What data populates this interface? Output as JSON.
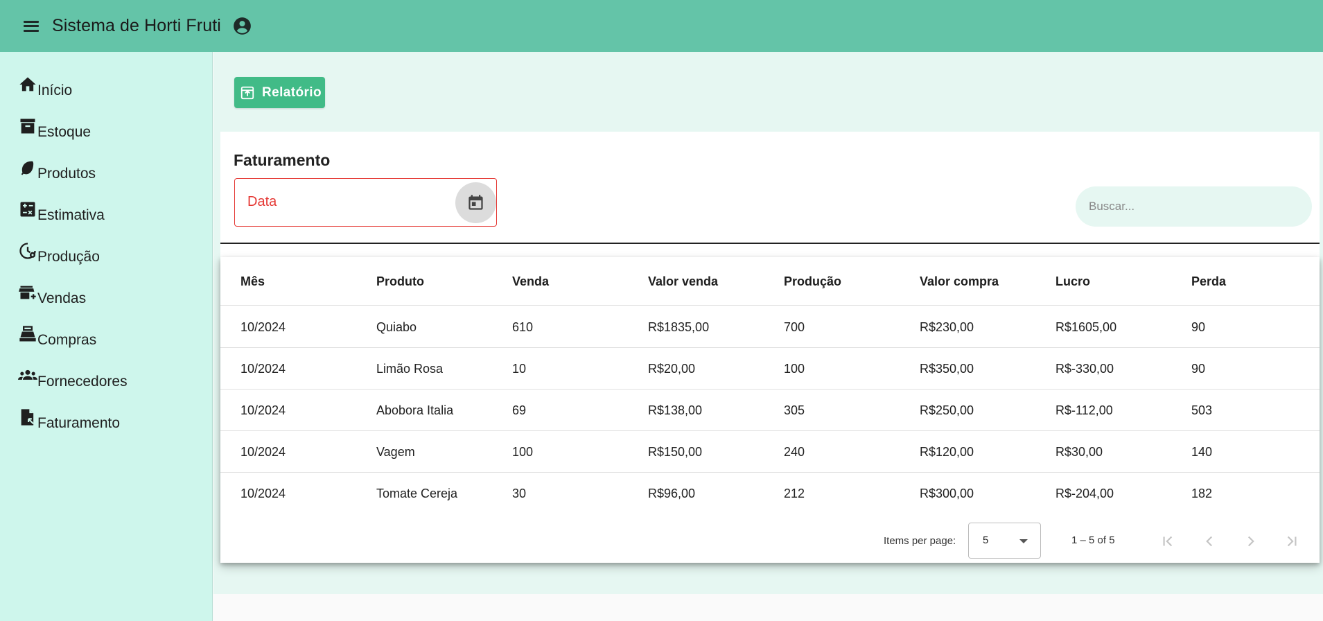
{
  "app": {
    "title": "Sistema de Horti Fruti"
  },
  "icons": {
    "menu": "menu-icon",
    "account": "account-circle-icon",
    "calendar": "calendar-icon",
    "report": "report-icon"
  },
  "colors": {
    "header": "#64c4a8",
    "sidebar": "#cef6ec",
    "content": "#e6f7f2",
    "primary_button": "#41bb87",
    "error": "#e53935"
  },
  "sidebar": {
    "items": [
      {
        "label": "Início",
        "icon": "home-icon"
      },
      {
        "label": "Estoque",
        "icon": "archive-icon"
      },
      {
        "label": "Produtos",
        "icon": "leaf-icon"
      },
      {
        "label": "Estimativa",
        "icon": "calculator-icon"
      },
      {
        "label": "Produção",
        "icon": "history-settings-icon"
      },
      {
        "label": "Vendas",
        "icon": "store-add-icon"
      },
      {
        "label": "Compras",
        "icon": "cash-register-icon"
      },
      {
        "label": "Fornecedores",
        "icon": "groups-icon"
      },
      {
        "label": "Faturamento",
        "icon": "file-export-icon"
      }
    ]
  },
  "toolbar": {
    "report_label": "Relatório"
  },
  "main": {
    "title": "Faturamento",
    "date_placeholder": "Data",
    "search_placeholder": "Buscar..."
  },
  "table": {
    "columns": [
      "Mês",
      "Produto",
      "Venda",
      "Valor venda",
      "Produção",
      "Valor compra",
      "Lucro",
      "Perda"
    ],
    "rows": [
      [
        "10/2024",
        "Quiabo",
        "610",
        "R$1835,00",
        "700",
        "R$230,00",
        "R$1605,00",
        "90"
      ],
      [
        "10/2024",
        "Limão Rosa",
        "10",
        "R$20,00",
        "100",
        "R$350,00",
        "R$-330,00",
        "90"
      ],
      [
        "10/2024",
        "Abobora Italia",
        "69",
        "R$138,00",
        "305",
        "R$250,00",
        "R$-112,00",
        "503"
      ],
      [
        "10/2024",
        "Vagem",
        "100",
        "R$150,00",
        "240",
        "R$120,00",
        "R$30,00",
        "140"
      ],
      [
        "10/2024",
        "Tomate Cereja",
        "30",
        "R$96,00",
        "212",
        "R$300,00",
        "R$-204,00",
        "182"
      ]
    ]
  },
  "paginator": {
    "items_per_page_label": "Items per page:",
    "page_size": "5",
    "range_label": "1 – 5 of 5"
  }
}
